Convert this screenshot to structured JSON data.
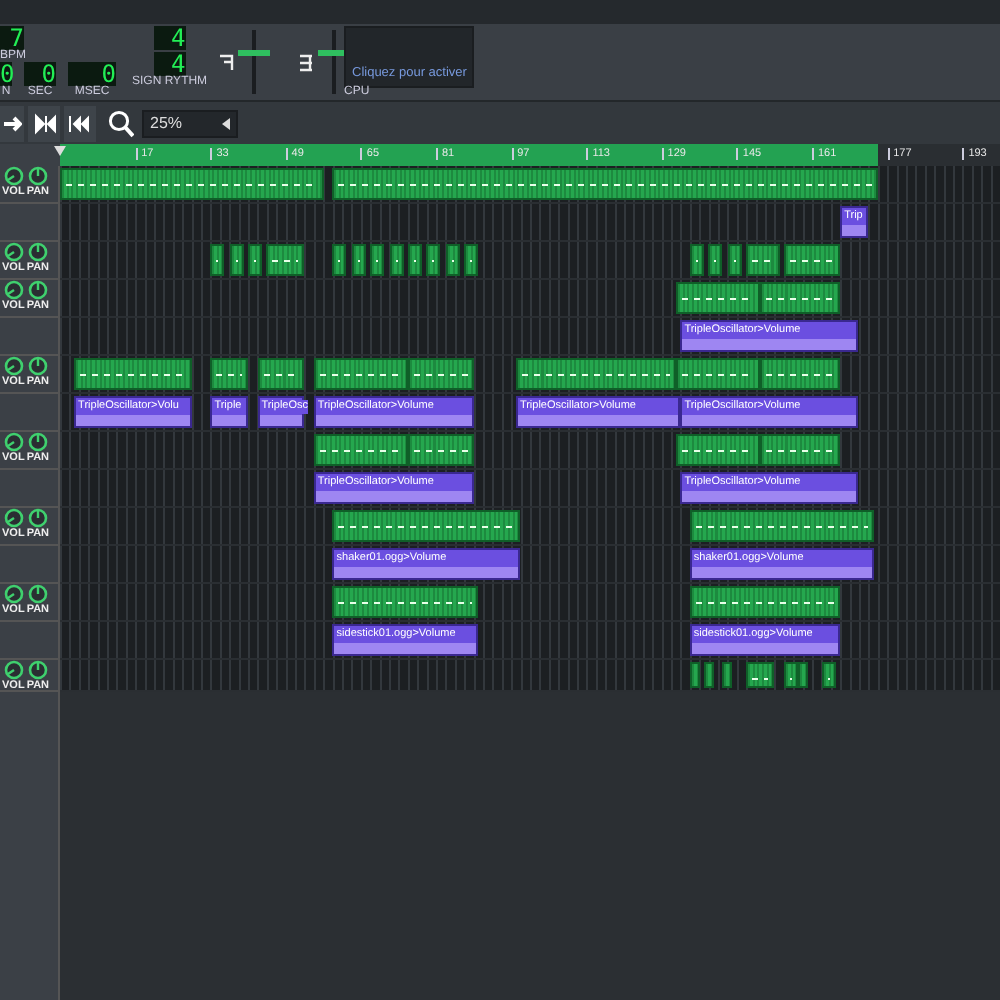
{
  "transport": {
    "tempo": "7",
    "tempo_label": "BPM",
    "time": [
      {
        "value": "0",
        "label": "N"
      },
      {
        "value": "0",
        "label": "SEC"
      },
      {
        "value": "0",
        "label": "MSEC"
      }
    ],
    "signature": {
      "numerator": "4",
      "denominator": "4",
      "label": "SIGN RYTHM"
    }
  },
  "master_volume": {
    "level": 0.65
  },
  "master_pitch": {
    "level": 0.65
  },
  "cpu": {
    "hint": "Cliquez pour activer",
    "label": "CPU"
  },
  "zoom": {
    "value": "25%"
  },
  "ruler": {
    "marks": [
      "17",
      "33",
      "49",
      "65",
      "81",
      "97",
      "113",
      "129",
      "145",
      "161",
      "177",
      "193"
    ],
    "loop": {
      "enabled": true
    }
  },
  "tracks": [
    {
      "kind": "instrument",
      "knobs": [
        "VOL",
        "PAN"
      ],
      "clips": [
        {
          "kind": "pattern"
        },
        {
          "kind": "pattern"
        }
      ]
    },
    {
      "kind": "automation",
      "clips": [
        {
          "kind": "automation",
          "label": "Trip"
        }
      ]
    },
    {
      "kind": "instrument",
      "knobs": [
        "VOL",
        "PAN"
      ],
      "clips": [
        {
          "kind": "pattern"
        },
        {
          "kind": "pattern"
        },
        {
          "kind": "pattern"
        },
        {
          "kind": "pattern"
        },
        {
          "kind": "pattern"
        },
        {
          "kind": "pattern"
        },
        {
          "kind": "pattern"
        },
        {
          "kind": "pattern"
        },
        {
          "kind": "pattern"
        },
        {
          "kind": "pattern"
        },
        {
          "kind": "pattern"
        },
        {
          "kind": "pattern"
        },
        {
          "kind": "pattern"
        },
        {
          "kind": "pattern"
        },
        {
          "kind": "pattern"
        },
        {
          "kind": "pattern"
        },
        {
          "kind": "pattern"
        }
      ]
    },
    {
      "kind": "instrument",
      "knobs": [
        "VOL",
        "PAN"
      ],
      "clips": [
        {
          "kind": "pattern"
        },
        {
          "kind": "pattern"
        }
      ]
    },
    {
      "kind": "automation",
      "clips": [
        {
          "kind": "automation",
          "label": "TripleOscillator>Volume"
        }
      ]
    },
    {
      "kind": "instrument",
      "knobs": [
        "VOL",
        "PAN"
      ],
      "clips": [
        {
          "kind": "pattern"
        },
        {
          "kind": "pattern"
        },
        {
          "kind": "pattern"
        },
        {
          "kind": "pattern"
        },
        {
          "kind": "pattern"
        },
        {
          "kind": "pattern"
        },
        {
          "kind": "pattern"
        },
        {
          "kind": "pattern"
        }
      ]
    },
    {
      "kind": "automation",
      "clips": [
        {
          "kind": "automation",
          "label": "TripleOscillator>Volu"
        },
        {
          "kind": "automation",
          "label": "Triple"
        },
        {
          "kind": "automation",
          "label": "TripleOsc"
        },
        {
          "kind": "automation",
          "label": "TripleOscillator>Volume"
        },
        {
          "kind": "automation",
          "label": "TripleOscillator>Volume"
        },
        {
          "kind": "automation",
          "label": "TripleOscillator>Volume"
        }
      ]
    },
    {
      "kind": "instrument",
      "knobs": [
        "VOL",
        "PAN"
      ],
      "clips": [
        {
          "kind": "pattern"
        },
        {
          "kind": "pattern"
        },
        {
          "kind": "pattern"
        },
        {
          "kind": "pattern"
        }
      ]
    },
    {
      "kind": "automation",
      "clips": [
        {
          "kind": "automation",
          "label": "TripleOscillator>Volume"
        },
        {
          "kind": "automation",
          "label": "TripleOscillator>Volume"
        }
      ]
    },
    {
      "kind": "instrument",
      "knobs": [
        "VOL",
        "PAN"
      ],
      "clips": [
        {
          "kind": "pattern"
        },
        {
          "kind": "pattern"
        }
      ]
    },
    {
      "kind": "automation",
      "clips": [
        {
          "kind": "automation",
          "label": "shaker01.ogg>Volume"
        },
        {
          "kind": "automation",
          "label": "shaker01.ogg>Volume"
        }
      ]
    },
    {
      "kind": "instrument",
      "knobs": [
        "VOL",
        "PAN"
      ],
      "clips": [
        {
          "kind": "pattern"
        },
        {
          "kind": "pattern"
        }
      ]
    },
    {
      "kind": "automation",
      "clips": [
        {
          "kind": "automation",
          "label": "sidestick01.ogg>Volume"
        },
        {
          "kind": "automation",
          "label": "sidestick01.ogg>Volume"
        }
      ]
    },
    {
      "kind": "instrument",
      "knobs": [
        "VOL",
        "PAN"
      ],
      "clips": [
        {
          "kind": "pattern"
        },
        {
          "kind": "pattern"
        },
        {
          "kind": "pattern"
        },
        {
          "kind": "pattern"
        },
        {
          "kind": "pattern"
        },
        {
          "kind": "pattern"
        },
        {
          "kind": "pattern"
        }
      ]
    }
  ]
}
